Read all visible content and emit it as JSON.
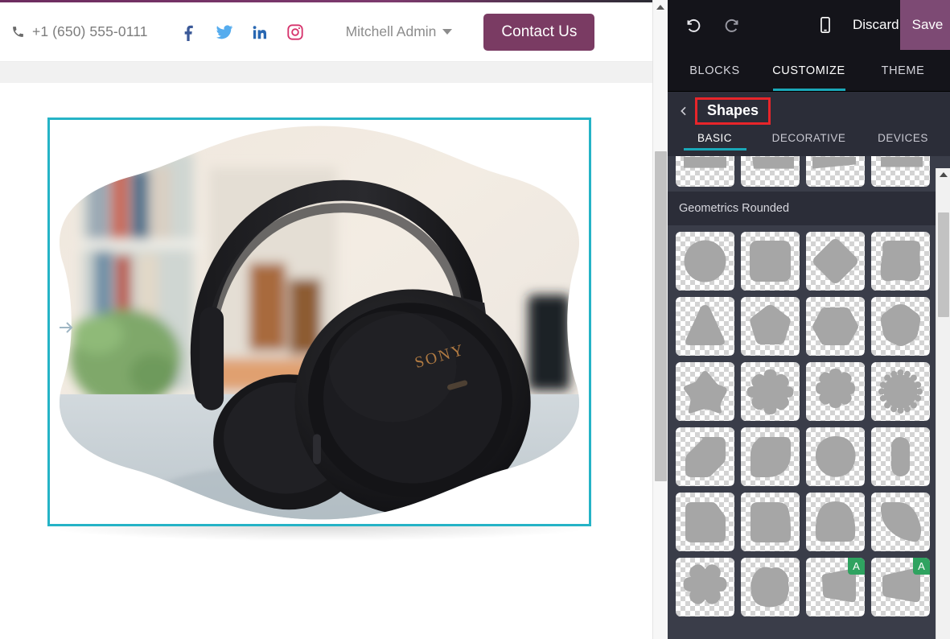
{
  "website": {
    "header": {
      "phone_icon": "phone-icon",
      "phone": "+1 (650) 555-0111",
      "socials": [
        {
          "name": "facebook-icon",
          "color": "#3b5998"
        },
        {
          "name": "twitter-icon",
          "color": "#55acee"
        },
        {
          "name": "linkedin-icon",
          "color": "#2867b2"
        },
        {
          "name": "instagram-icon",
          "color": "#d6336c"
        }
      ],
      "user_name": "Mitchell Admin",
      "user_caret_icon": "chevron-down-icon",
      "contact_button": "Contact Us",
      "contact_button_color": "#7a3b63"
    },
    "selection": {
      "border_color": "#25b3c6",
      "carousel_next_icon": "arrow-right-icon"
    },
    "image": {
      "alt": "Black Sony over-ear headphones on a desk with blurred bookshelf background",
      "brand_text": "SONY",
      "mask_shape": "blob-flower"
    },
    "scrollbar": {
      "up_arrow_icon": "scroll-up-arrow-icon"
    }
  },
  "editor": {
    "toolbar": {
      "undo_icon": "undo-icon",
      "redo_icon": "redo-icon",
      "mobile_preview_icon": "mobile-device-icon",
      "discard_label": "Discard",
      "save_label": "Save",
      "save_color": "#7d4a74"
    },
    "main_tabs": [
      {
        "label": "BLOCKS",
        "active": false
      },
      {
        "label": "CUSTOMIZE",
        "active": true
      },
      {
        "label": "THEME",
        "active": false
      }
    ],
    "accent_color": "#1aa8b8",
    "panel": {
      "back_icon": "chevron-left-icon",
      "title": "Shapes",
      "title_highlight_color": "#e8252a"
    },
    "sub_tabs": [
      {
        "label": "BASIC",
        "active": true
      },
      {
        "label": "DECORATIVE",
        "active": false
      },
      {
        "label": "DEVICES",
        "active": false
      }
    ],
    "groups": [
      {
        "label": "",
        "clipped": true,
        "shapes": [
          {
            "name": "trapezoid-flat-top",
            "badge": null
          },
          {
            "name": "trapezoid-slanted",
            "badge": null
          },
          {
            "name": "trapezoid-wedge",
            "badge": null
          },
          {
            "name": "rectangle-band",
            "badge": null
          }
        ]
      },
      {
        "label": "Geometrics Rounded",
        "clipped": false,
        "shapes": [
          {
            "name": "circle",
            "badge": null
          },
          {
            "name": "rounded-square",
            "badge": null
          },
          {
            "name": "rounded-diamond",
            "badge": null
          },
          {
            "name": "squircle-wavy",
            "badge": null
          },
          {
            "name": "rounded-triangle",
            "badge": null
          },
          {
            "name": "rounded-pentagon",
            "badge": null
          },
          {
            "name": "rounded-hexagon",
            "badge": null
          },
          {
            "name": "rounded-heptagon",
            "badge": null
          },
          {
            "name": "rounded-star-5",
            "badge": null
          },
          {
            "name": "flower-6-petal",
            "badge": null
          },
          {
            "name": "flower-8-petal",
            "badge": null
          },
          {
            "name": "gear-starburst",
            "badge": null
          },
          {
            "name": "corner-cut-shape",
            "badge": null
          },
          {
            "name": "leaf-rounded",
            "badge": null
          },
          {
            "name": "egg-blob",
            "badge": null
          },
          {
            "name": "pill-vertical",
            "badge": null
          },
          {
            "name": "angled-corner-square",
            "badge": null
          },
          {
            "name": "dome-square",
            "badge": null
          },
          {
            "name": "arch-shape",
            "badge": null
          },
          {
            "name": "quarter-circle",
            "badge": null
          },
          {
            "name": "clover-4",
            "badge": null
          },
          {
            "name": "blob-rounded",
            "badge": null
          },
          {
            "name": "tilted-quad-left",
            "badge": "A"
          },
          {
            "name": "tilted-quad-right",
            "badge": "A"
          }
        ]
      }
    ],
    "badge_color": "#2fa360",
    "panel_scrollbar": {
      "up_arrow_icon": "scroll-up-arrow-icon"
    }
  }
}
